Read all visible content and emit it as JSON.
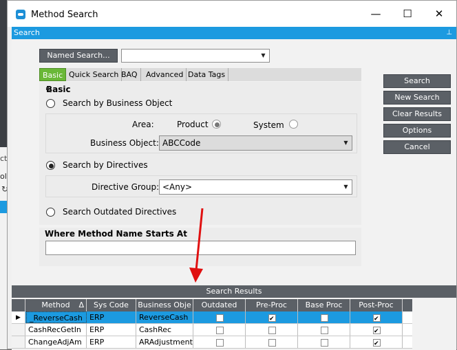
{
  "window": {
    "title": "Method Search",
    "controls": {
      "minimize": "—",
      "maximize": "☐",
      "close": "✕"
    }
  },
  "search_bar": {
    "label": "Search",
    "pin": "📌"
  },
  "named_search": {
    "button": "Named Search...",
    "value": ""
  },
  "tabs": [
    {
      "label": "Basic",
      "active": true
    },
    {
      "label": "Quick Search",
      "active": false
    },
    {
      "label": "BAQ",
      "active": false
    },
    {
      "label": "Advanced",
      "active": false
    },
    {
      "label": "Data Tags",
      "active": false
    }
  ],
  "basic": {
    "heading": "Basic",
    "radio_business_object": "Search by Business Object",
    "area_label": "Area:",
    "area_product": "Product",
    "area_system": "System",
    "business_object_label": "Business Object:",
    "business_object_value": "ABCCode",
    "radio_directives": "Search by Directives",
    "directive_group_label": "Directive Group:",
    "directive_group_value": "<Any>",
    "radio_outdated": "Search Outdated Directives",
    "where_heading": "Where Method Name Starts At",
    "where_value": ""
  },
  "side_buttons": [
    "Search",
    "New Search",
    "Clear Results",
    "Options",
    "Cancel"
  ],
  "results": {
    "title": "Search Results",
    "columns": [
      "Method",
      "Sys Code",
      "Business Obje",
      "Outdated",
      "Pre-Proc",
      "Base Proc",
      "Post-Proc"
    ],
    "sort_indicator": "Δ",
    "rows": [
      {
        "method": "_ReverseCash",
        "sys": "ERP",
        "bo": "ReverseCash",
        "outdated": false,
        "pre": true,
        "base": false,
        "post": true,
        "selected": true
      },
      {
        "method": "CashRecGetIn",
        "sys": "ERP",
        "bo": "CashRec",
        "outdated": false,
        "pre": false,
        "base": false,
        "post": true,
        "selected": false
      },
      {
        "method": "ChangeAdjAm",
        "sys": "ERP",
        "bo": "ARAdjustment",
        "outdated": false,
        "pre": false,
        "base": false,
        "post": true,
        "selected": false
      }
    ]
  },
  "background_fragments": {
    "a": "cti",
    "b": "ols"
  },
  "colors": {
    "accent": "#1c9ae0",
    "tab_active": "#6ab838",
    "button_dark": "#5b6066",
    "arrow": "#e01010"
  }
}
